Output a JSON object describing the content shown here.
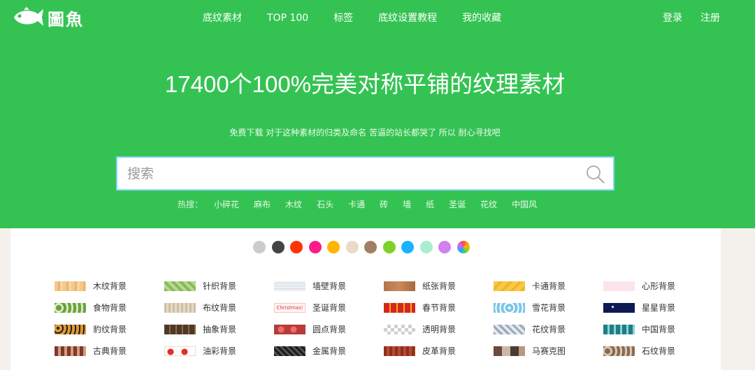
{
  "header": {
    "logo_text": "圖魚",
    "nav": [
      "底纹素材",
      "TOP 100",
      "标签",
      "底纹设置教程",
      "我的收藏"
    ],
    "auth": {
      "login": "登录",
      "register": "注册"
    }
  },
  "hero": {
    "headline": "17400个100%完美对称平铺的纹理素材",
    "subline": "免费下载 对于这种素材的归类及命名 苦逼的站长都哭了 所以 耐心寻找吧",
    "search": {
      "placeholder": "搜索",
      "value": ""
    },
    "hot_label": "热搜：",
    "hot_terms": [
      "小碎花",
      "麻布",
      "木纹",
      "石头",
      "卡通",
      "砖",
      "墙",
      "纸",
      "圣诞",
      "花纹",
      "中国风"
    ]
  },
  "colors": {
    "swatches": [
      "#cccccc",
      "#444444",
      "#ff3300",
      "#ff1a8c",
      "#ffb400",
      "#eadbc8",
      "#a27f63",
      "#7fd12b",
      "#1ab2ff",
      "#a9efcf",
      "#d27fef",
      "rainbow"
    ]
  },
  "categories": [
    {
      "label": "木纹背景",
      "thumb": "wood"
    },
    {
      "label": "针织背景",
      "thumb": "knit"
    },
    {
      "label": "墙壁背景",
      "thumb": "wall"
    },
    {
      "label": "纸张背景",
      "thumb": "paper"
    },
    {
      "label": "卡通背景",
      "thumb": "cartoon"
    },
    {
      "label": "心形背景",
      "thumb": "heart"
    },
    {
      "label": "食物背景",
      "thumb": "food"
    },
    {
      "label": "布纹背景",
      "thumb": "cloth"
    },
    {
      "label": "圣诞背景",
      "thumb": "xmas"
    },
    {
      "label": "春节背景",
      "thumb": "spring"
    },
    {
      "label": "雪花背景",
      "thumb": "snow"
    },
    {
      "label": "星星背景",
      "thumb": "star"
    },
    {
      "label": "豹纹背景",
      "thumb": "leopard"
    },
    {
      "label": "抽象背景",
      "thumb": "abstract"
    },
    {
      "label": "圆点背景",
      "thumb": "dots"
    },
    {
      "label": "透明背景",
      "thumb": "transparent"
    },
    {
      "label": "花纹背景",
      "thumb": "floral"
    },
    {
      "label": "中国背景",
      "thumb": "chinese"
    },
    {
      "label": "古典背景",
      "thumb": "classic"
    },
    {
      "label": "油彩背景",
      "thumb": "oil"
    },
    {
      "label": "金属背景",
      "thumb": "metal"
    },
    {
      "label": "皮革背景",
      "thumb": "leather"
    },
    {
      "label": "马赛克图",
      "thumb": "mosaic"
    },
    {
      "label": "石纹背景",
      "thumb": "stone"
    }
  ],
  "xmas_thumb_text": "Christmas!"
}
